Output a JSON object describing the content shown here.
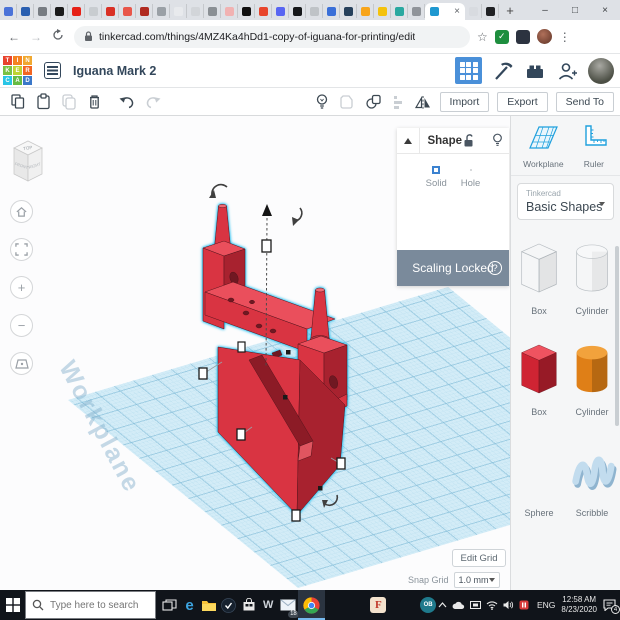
{
  "browser": {
    "url": "tinkercad.com/things/4MZ4Ka4hDd1-copy-of-iguana-for-printing/edit",
    "tab_favicon_colors": [
      "#4a72d8",
      "#2a5fb0",
      "#777c82",
      "#1b1b1b",
      "#e62117",
      "#c8ccd0",
      "#d93025",
      "#e8564a",
      "#b02a20",
      "#9aa0a6",
      "#e8eaed",
      "#d2d5d9",
      "#8a8f94",
      "#f1b2b2",
      "#101010",
      "#e8452c",
      "#5865f2",
      "#15171a",
      "#bfc3c7",
      "#3a6fd8",
      "#27415c",
      "#f8a51b",
      "#f4c20d",
      "#2aa8a0",
      "#90949a"
    ],
    "after_tab_colors": [
      "#d8dbe0",
      "#202124"
    ],
    "active_tab_close": "×",
    "new_tab": "+",
    "nav_back": "←",
    "nav_forward": "→",
    "bookmark_star": "☆",
    "menu_dots": "⋮",
    "ext_check": "✓",
    "win_min": "–",
    "win_max": "□",
    "win_close": "×"
  },
  "header": {
    "logo_letters": [
      "T",
      "I",
      "N",
      "K",
      "E",
      "R",
      "C",
      "A",
      "D"
    ],
    "logo_colors": [
      "#e8432d",
      "#f58220",
      "#f0a830",
      "#7ac143",
      "#bfd330",
      "#f26522",
      "#29c5e6",
      "#66bb44",
      "#3b78c9"
    ],
    "design_title": "Iguana Mark 2"
  },
  "toolbar": {
    "import_label": "Import",
    "export_label": "Export",
    "send_to_label": "Send To"
  },
  "shape_panel": {
    "title": "Shape",
    "solid_label": "Solid",
    "hole_label": "Hole",
    "banner_text": "Scaling Locked",
    "help_glyph": "?"
  },
  "view_cube": {
    "top": "TOP",
    "front": "FRONT",
    "right": "RIGHT"
  },
  "canvas": {
    "watermark": "Workplane",
    "edit_grid_label": "Edit Grid",
    "snap_grid_label": "Snap Grid",
    "snap_grid_value": "1.0 mm"
  },
  "sidebar": {
    "workplane_label": "Workplane",
    "ruler_label": "Ruler",
    "library_brand": "Tinkercad",
    "library_name": "Basic Shapes",
    "gallery": [
      {
        "label": "Box",
        "style": "striped"
      },
      {
        "label": "Cylinder",
        "style": "striped"
      },
      {
        "label": "Box",
        "style": "red"
      },
      {
        "label": "Cylinder",
        "style": "orange"
      },
      {
        "label": "Sphere",
        "style": "blue"
      },
      {
        "label": "Scribble",
        "style": "lightblue"
      }
    ]
  },
  "taskbar": {
    "search_placeholder": "Type here to search",
    "edge_glyph": "e",
    "w_glyph": "W",
    "f_glyph": "F",
    "ob_glyph": "OB",
    "mail_badge": "18",
    "language": "ENG",
    "time": "12:58 AM",
    "date": "8/23/2020",
    "notification_badge": "4"
  },
  "colors": {
    "selection_cyan": "#2ec3f2",
    "model_red": "#d93442",
    "workplane_blue": "#d3ecf7",
    "accent_blue": "#4a90d9",
    "banner_slate": "#7a8a9b"
  }
}
